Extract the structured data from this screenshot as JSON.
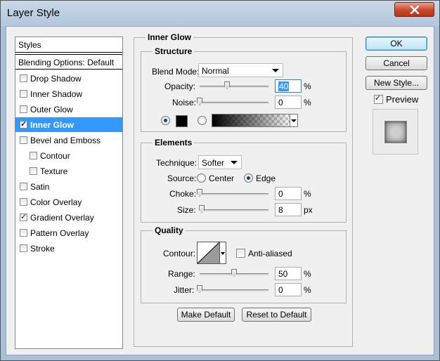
{
  "window": {
    "title": "Layer Style"
  },
  "styles_panel": {
    "header": "Styles",
    "blending_options": "Blending Options: Default",
    "items": [
      {
        "label": "Drop Shadow",
        "checked": false,
        "selected": false,
        "indent": false
      },
      {
        "label": "Inner Shadow",
        "checked": false,
        "selected": false,
        "indent": false
      },
      {
        "label": "Outer Glow",
        "checked": false,
        "selected": false,
        "indent": false
      },
      {
        "label": "Inner Glow",
        "checked": true,
        "selected": true,
        "indent": false
      },
      {
        "label": "Bevel and Emboss",
        "checked": false,
        "selected": false,
        "indent": false
      },
      {
        "label": "Contour",
        "checked": false,
        "selected": false,
        "indent": true
      },
      {
        "label": "Texture",
        "checked": false,
        "selected": false,
        "indent": true
      },
      {
        "label": "Satin",
        "checked": false,
        "selected": false,
        "indent": false
      },
      {
        "label": "Color Overlay",
        "checked": false,
        "selected": false,
        "indent": false
      },
      {
        "label": "Gradient Overlay",
        "checked": true,
        "selected": false,
        "indent": false
      },
      {
        "label": "Pattern Overlay",
        "checked": false,
        "selected": false,
        "indent": false
      },
      {
        "label": "Stroke",
        "checked": false,
        "selected": false,
        "indent": false
      }
    ]
  },
  "inner_glow": {
    "title": "Inner Glow",
    "structure": {
      "title": "Structure",
      "blend_mode_label": "Blend Mode:",
      "blend_mode_value": "Normal",
      "opacity_label": "Opacity:",
      "opacity_value": "40",
      "opacity_level": 0.4,
      "noise_label": "Noise:",
      "noise_value": "0",
      "noise_level": 0,
      "percent": "%",
      "swatch_color": "#000000"
    },
    "elements": {
      "title": "Elements",
      "technique_label": "Technique:",
      "technique_value": "Softer",
      "source_label": "Source:",
      "source_center": "Center",
      "source_edge": "Edge",
      "choke_label": "Choke:",
      "choke_value": "0",
      "choke_level": 0,
      "size_label": "Size:",
      "size_value": "8",
      "size_level": 0.032,
      "percent": "%",
      "px": "px"
    },
    "quality": {
      "title": "Quality",
      "contour_label": "Contour:",
      "anti_aliased_label": "Anti-aliased",
      "range_label": "Range:",
      "range_value": "50",
      "range_level": 0.5,
      "jitter_label": "Jitter:",
      "jitter_value": "0",
      "jitter_level": 0,
      "percent": "%"
    },
    "make_default": "Make Default",
    "reset_default": "Reset to Default"
  },
  "right_panel": {
    "ok": "OK",
    "cancel": "Cancel",
    "new_style": "New Style...",
    "preview_label": "Preview",
    "preview_checked": true
  },
  "colors": {
    "selection": "#3399ff",
    "close_button": "#c8482c",
    "window_frame": "#a9c0d9"
  }
}
